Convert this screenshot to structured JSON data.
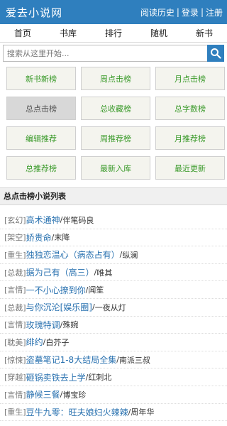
{
  "site": {
    "logo": "爱去小说网"
  },
  "user_links": {
    "history": "阅读历史",
    "login": "登录",
    "register": "注册",
    "separator": "|"
  },
  "nav": [
    "首页",
    "书库",
    "排行",
    "随机",
    "新书"
  ],
  "search": {
    "placeholder": "搜索从这里开始...",
    "button_icon": "search-icon"
  },
  "rank_buttons": [
    "新书新榜",
    "周点击榜",
    "月点击榜",
    "总点击榜",
    "总收藏榜",
    "总字数榜",
    "编辑推荐",
    "周推荐榜",
    "月推荐榜",
    "总推荐榜",
    "最新入库",
    "最近更新"
  ],
  "active_rank": "总点击榜",
  "section_title": "总点击榜小说列表",
  "books": [
    {
      "category": "[玄幻]",
      "title": "高术通神",
      "author": "伴笔码良"
    },
    {
      "category": "[架空]",
      "title": "娇贵命",
      "author": "末降"
    },
    {
      "category": "[重生]",
      "title": "独独恋温心（病态占有）",
      "author": "纵澜"
    },
    {
      "category": "[总裁]",
      "title": "据为己有（高三）",
      "author": "唯其"
    },
    {
      "category": "[言情]",
      "title": "一不小心撩到你",
      "author": "闻笙"
    },
    {
      "category": "[总裁]",
      "title": "与你沉沦[娱乐圈]",
      "author": "一夜从灯"
    },
    {
      "category": "[言情]",
      "title": "玫瑰特调",
      "author": "殊婉"
    },
    {
      "category": "[耽美]",
      "title": "绯约",
      "author": "白芥子"
    },
    {
      "category": "[惊悚]",
      "title": "盗墓笔记1-8大结局全集",
      "author": "南派三叔"
    },
    {
      "category": "[穿越]",
      "title": "砸锅卖铁去上学",
      "author": "红刺北"
    },
    {
      "category": "[言情]",
      "title": "静候三餐",
      "author": "博宝珍"
    },
    {
      "category": "[重生]",
      "title": "豆牛九零：旺夫娘妇火辣辣",
      "author": "周年华"
    }
  ],
  "colors": {
    "header": "#2f7fbe",
    "rank_text": "#3a9a2a",
    "title_link": "#2a72b0"
  }
}
